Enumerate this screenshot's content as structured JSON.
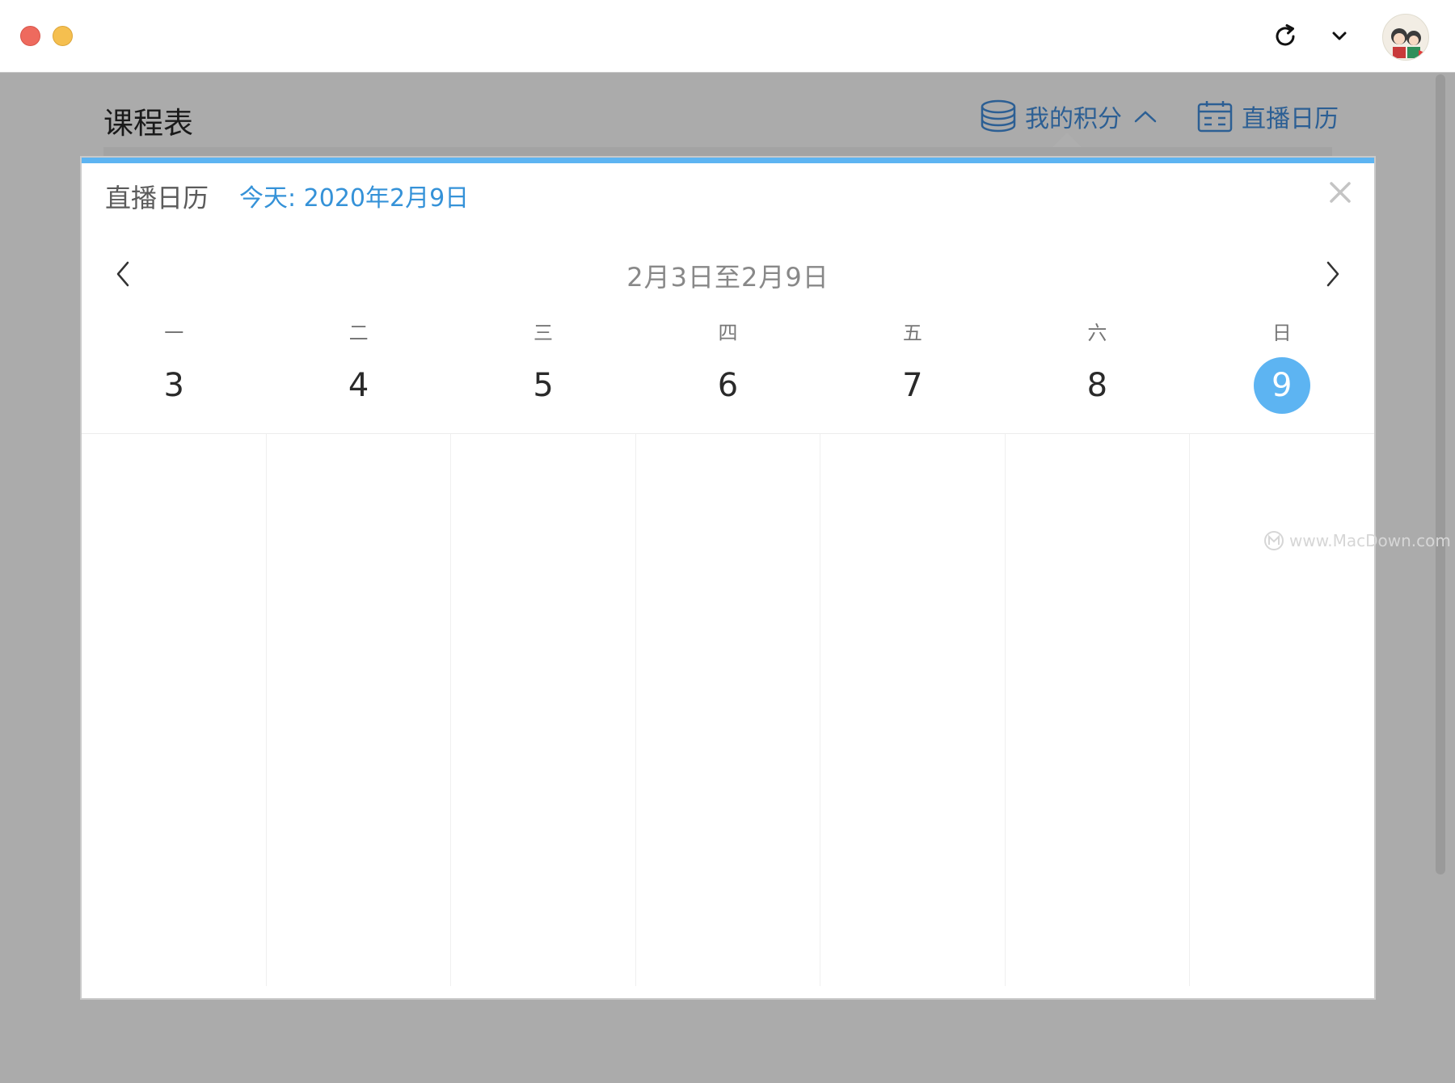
{
  "header": {
    "page_title": "课程表",
    "points_label": "我的积分",
    "calendar_label": "直播日历"
  },
  "calendar_panel": {
    "title": "直播日历",
    "today": "今天: 2020年2月9日",
    "week_range": "2月3日至2月9日",
    "weekdays": [
      "一",
      "二",
      "三",
      "四",
      "五",
      "六",
      "日"
    ],
    "dates": [
      "3",
      "4",
      "5",
      "6",
      "7",
      "8",
      "9"
    ],
    "selected_index": 6
  },
  "watermark": "www.MacDown.com",
  "colors": {
    "accent": "#5db4f2",
    "link": "#2c5f94",
    "today_text": "#3592d8"
  },
  "icons": {
    "refresh": "refresh-icon",
    "dropdown": "chevron-down-icon",
    "points": "coins-stack-icon",
    "calendar": "calendar-icon",
    "close": "close-icon",
    "prev": "chevron-left-icon",
    "next": "chevron-right-icon"
  }
}
